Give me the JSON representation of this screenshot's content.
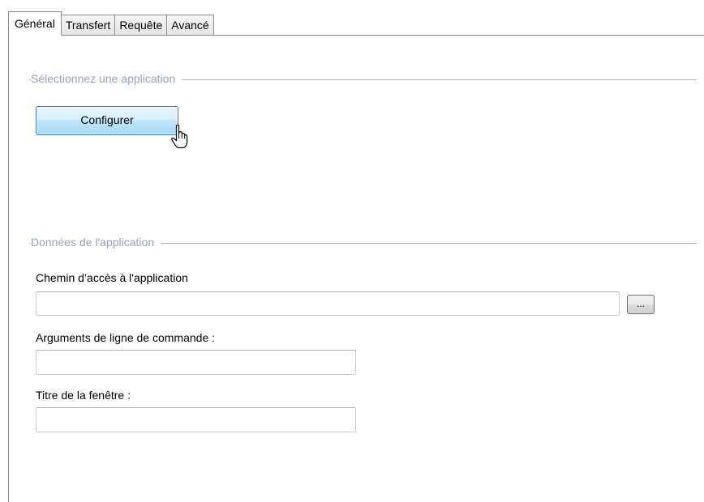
{
  "tabs": [
    {
      "label": "Général",
      "active": true
    },
    {
      "label": "Transfert",
      "active": false
    },
    {
      "label": "Requête",
      "active": false
    },
    {
      "label": "Avancé",
      "active": false
    }
  ],
  "select_group": {
    "title": "Sélectionnez une application",
    "configure_button_label": "Configurer"
  },
  "data_group": {
    "title": "Données de l'application",
    "path_label": "Chemin d’accès à l'application",
    "path_value": "",
    "browse_button_label": "...",
    "args_label": "Arguments de ligne de commande :",
    "args_value": "",
    "window_title_label": "Titre de la fenêtre :",
    "window_title_value": ""
  },
  "colors": {
    "group_label": "#8fa4c8",
    "button_border": "#3c7fb1",
    "tab_border": "#898c95"
  },
  "icons": {
    "cursor": "mouse-pointer-icon"
  }
}
